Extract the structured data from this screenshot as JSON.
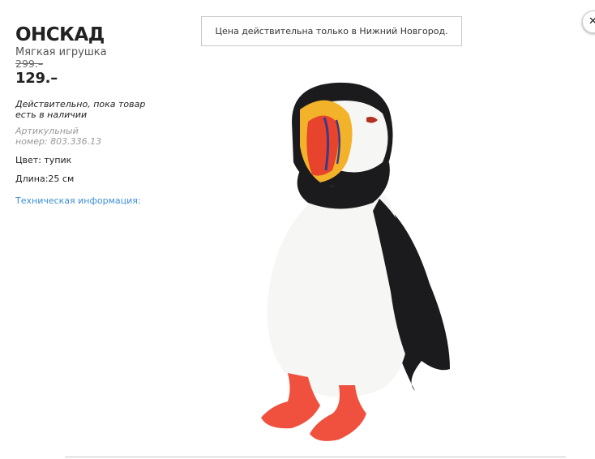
{
  "product": {
    "name": "ОНСКАД",
    "type": "Мягкая игрушка",
    "old_price": "299.–",
    "new_price": "129.–",
    "availability": "Действительно, пока товар есть в наличии",
    "article": "Артикульный номер: 803.336.13",
    "color": "Цвет: тупик",
    "length": "Длина:25 см",
    "tech_info_link": "Техническая информация:"
  },
  "notice": "Цена действительна только в Нижний Новгород.",
  "close_glyph": "✕",
  "image": {
    "icon": "puffin-plush-toy",
    "colors": {
      "black": "#1b1b1d",
      "white": "#f6f6f4",
      "beak_red": "#e8432c",
      "beak_yellow": "#f2b32a",
      "feet": "#f0503e"
    }
  }
}
